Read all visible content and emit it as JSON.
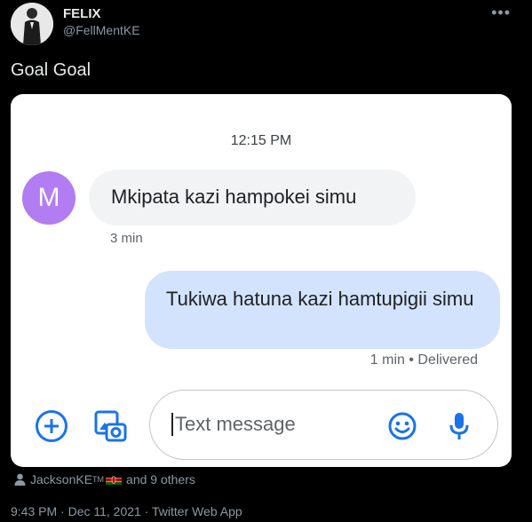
{
  "tweet": {
    "display_name": "FELIX",
    "handle": "@FellMentKE",
    "more_icon": "•••",
    "text": "Goal Goal"
  },
  "screenshot": {
    "time": "12:15 PM",
    "sender_initial": "M",
    "incoming_message": "Mkipata kazi hampokei simu",
    "incoming_meta": "3 min",
    "outgoing_message": "Tukiwa hatuna kazi hamtupigii simu",
    "outgoing_meta": "1 min • Delivered",
    "input_placeholder": "Text message",
    "accent_color": "#1a73e8",
    "avatar_color": "#b27cf2",
    "outgoing_bubble_color": "#d3e3fd",
    "incoming_bubble_color": "#f1f3f4"
  },
  "social": {
    "liked_by_user": "JacksonKE",
    "liked_by_tm": "TM",
    "liked_by_rest": "and 9 others"
  },
  "footer": {
    "meta": "9:43 PM · Dec 11, 2021 · Twitter Web App"
  }
}
